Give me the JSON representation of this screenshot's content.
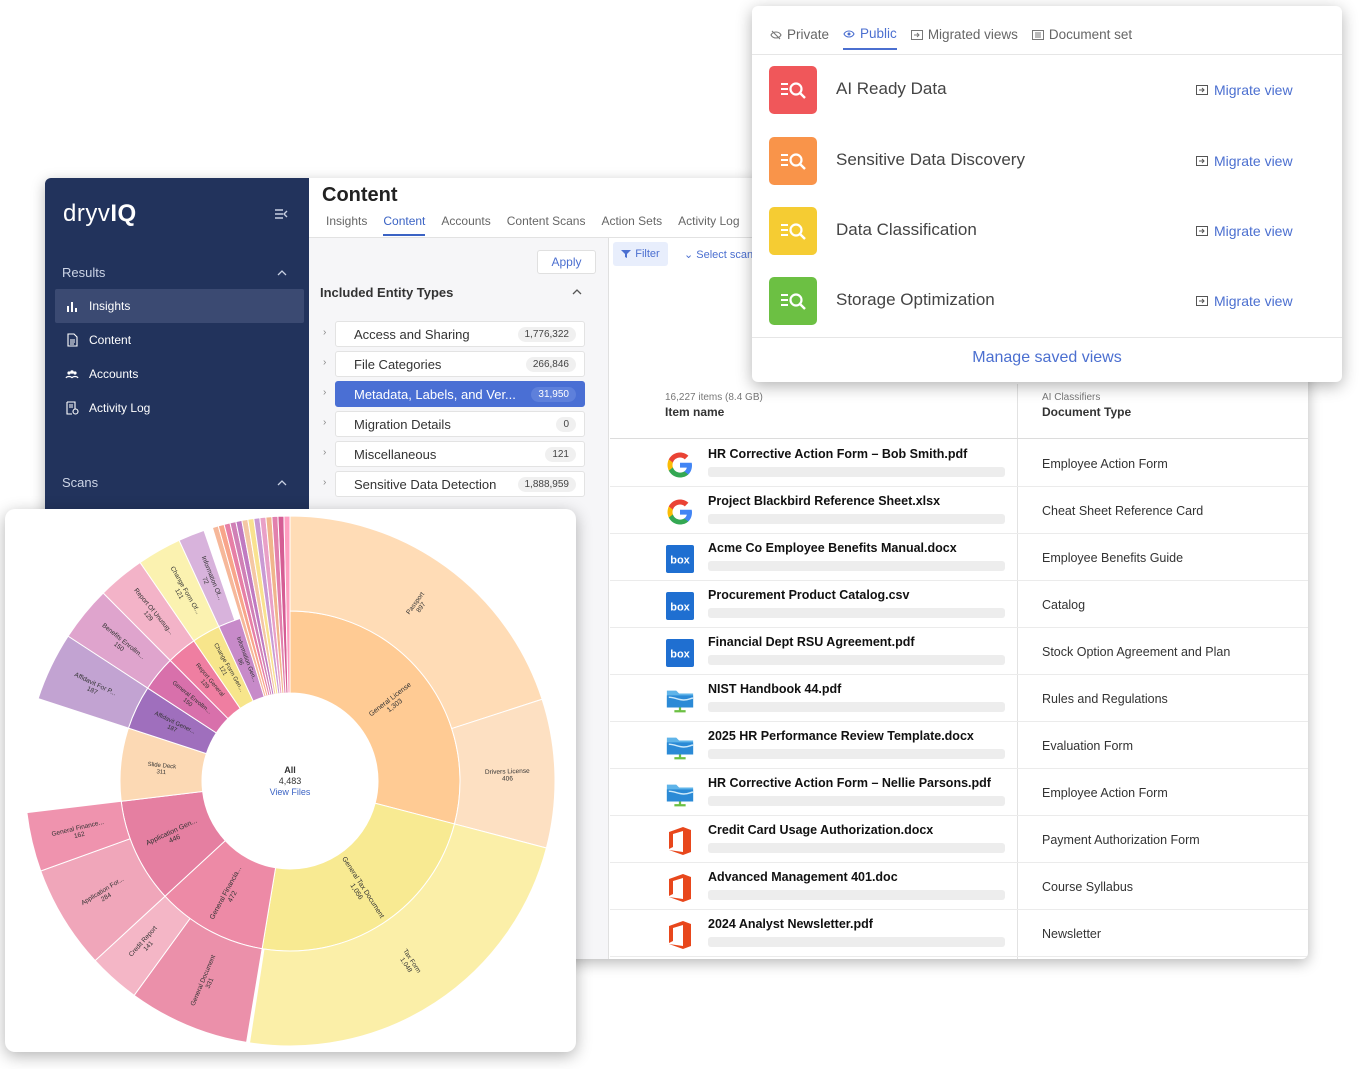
{
  "app": {
    "logo_main": "dryv",
    "logo_bold": "IQ",
    "sidebar": {
      "results_label": "Results",
      "items": [
        {
          "label": "Insights",
          "icon": "bar-chart-icon"
        },
        {
          "label": "Content",
          "icon": "document-icon"
        },
        {
          "label": "Accounts",
          "icon": "users-icon"
        },
        {
          "label": "Activity Log",
          "icon": "activity-log-icon"
        }
      ],
      "scans_label": "Scans"
    },
    "page_title": "Content",
    "tabs": [
      "Insights",
      "Content",
      "Accounts",
      "Content Scans",
      "Action Sets",
      "Activity Log"
    ],
    "active_tab": "Content",
    "filter_panel": {
      "apply_label": "Apply",
      "title": "Included Entity Types",
      "rows": [
        {
          "label": "Access and Sharing",
          "count": "1,776,322"
        },
        {
          "label": "File Categories",
          "count": "266,846"
        },
        {
          "label": "Metadata, Labels, and Ver...",
          "count": "31,950"
        },
        {
          "label": "Migration Details",
          "count": "0"
        },
        {
          "label": "Miscellaneous",
          "count": "121"
        },
        {
          "label": "Sensitive Data Detection",
          "count": "1,888,959"
        }
      ]
    },
    "toolbar": {
      "filter_label": "Filter",
      "select_scan_label": "Select scan"
    },
    "table": {
      "summary": "16,227 items (8.4 GB)",
      "col1_header": "Item name",
      "col2_group": "AI Classifiers",
      "col2_header": "Document Type",
      "rows": [
        {
          "name": "HR Corrective Action Form – Bob Smith.pdf",
          "type": "Employee Action Form",
          "icon": "google-icon"
        },
        {
          "name": "Project Blackbird Reference Sheet.xlsx",
          "type": "Cheat Sheet Reference Card",
          "icon": "google-icon"
        },
        {
          "name": "Acme Co Employee Benefits Manual.docx",
          "type": "Employee Benefits Guide",
          "icon": "box-icon"
        },
        {
          "name": "Procurement Product Catalog.csv",
          "type": "Catalog",
          "icon": "box-icon"
        },
        {
          "name": "Financial Dept RSU Agreement.pdf",
          "type": "Stock Option Agreement and Plan",
          "icon": "box-icon"
        },
        {
          "name": "NIST Handbook 44.pdf",
          "type": "Rules and Regulations",
          "icon": "network-folder-icon"
        },
        {
          "name": "2025 HR Performance Review Template.docx",
          "type": "Evaluation Form",
          "icon": "network-folder-icon"
        },
        {
          "name": "HR Corrective Action Form – Nellie Parsons.pdf",
          "type": "Employee Action Form",
          "icon": "network-folder-icon"
        },
        {
          "name": "Credit Card Usage Authorization.docx",
          "type": "Payment Authorization Form",
          "icon": "office-icon"
        },
        {
          "name": "Advanced Management 401.doc",
          "type": "Course Syllabus",
          "icon": "office-icon"
        },
        {
          "name": "2024 Analyst Newsletter.pdf",
          "type": "Newsletter",
          "icon": "office-icon"
        }
      ]
    }
  },
  "views_popup": {
    "tabs": [
      {
        "label": "Private",
        "icon": "eye-off-icon"
      },
      {
        "label": "Public",
        "icon": "eye-icon"
      },
      {
        "label": "Migrated views",
        "icon": "migrate-icon"
      },
      {
        "label": "Document set",
        "icon": "document-set-icon"
      }
    ],
    "active_tab": "Public",
    "views": [
      {
        "name": "AI Ready Data",
        "color": "#f0575a",
        "action": "Migrate view"
      },
      {
        "name": "Sensitive Data Discovery",
        "color": "#f9944a",
        "action": "Migrate view"
      },
      {
        "name": "Data Classification",
        "color": "#f5cc33",
        "action": "Migrate view"
      },
      {
        "name": "Storage Optimization",
        "color": "#6cc043",
        "action": "Migrate view"
      }
    ],
    "footer_link": "Manage saved views"
  },
  "sunburst": {
    "center_label": "All",
    "center_count": "4,483",
    "center_link": "View Files"
  },
  "chart_data": {
    "type": "sunburst",
    "total": 4483,
    "center": {
      "label": "All",
      "count": 4483
    },
    "inner_ring": [
      {
        "label": "General License",
        "value": 1303
      },
      {
        "label": "General Tax Document",
        "value": 1056
      },
      {
        "label": "General Financia...",
        "value": 472
      },
      {
        "label": "Application Gen...",
        "value": 446
      },
      {
        "label": "Slide Deck",
        "value": 311
      },
      {
        "label": "Affidavit Gener...",
        "value": 187
      },
      {
        "label": "General Enrollm...",
        "value": 150
      },
      {
        "label": "Report General",
        "value": 129
      },
      {
        "label": "Change Form Gen...",
        "value": 121
      },
      {
        "label": "Information Gen...",
        "value": 96
      }
    ],
    "outer_ring": [
      {
        "label": "Passport",
        "value": 897
      },
      {
        "label": "Drivers License",
        "value": 406
      },
      {
        "label": "Tax Form",
        "value": 1048
      },
      {
        "label": "General Document",
        "value": 331
      },
      {
        "label": "Credit Report",
        "value": 141
      },
      {
        "label": "Application For...",
        "value": 284
      },
      {
        "label": "General Finance...",
        "value": 162
      },
      {
        "label": "Affidavit For P...",
        "value": 187
      },
      {
        "label": "Benefits Enrollm...",
        "value": 150
      },
      {
        "label": "Report Of Unusug...",
        "value": 129
      },
      {
        "label": "Change Form Of...",
        "value": 121
      },
      {
        "label": "Information Of...",
        "value": 72
      }
    ]
  }
}
